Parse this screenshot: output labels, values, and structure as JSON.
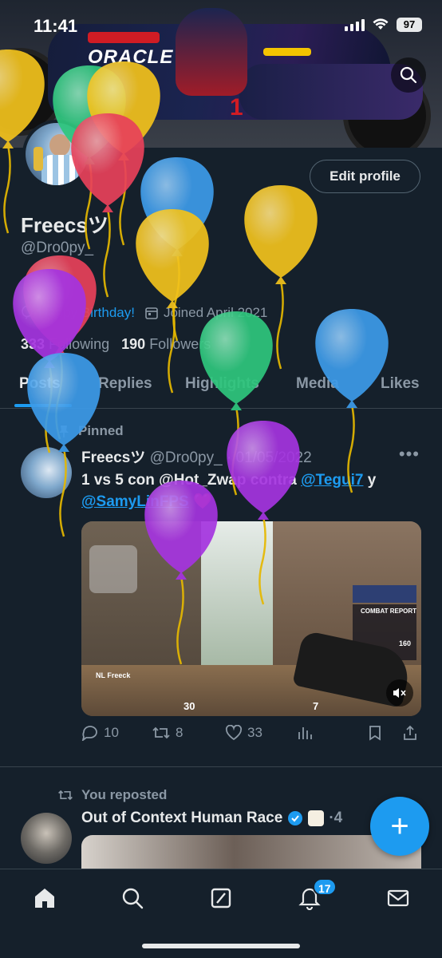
{
  "status_bar": {
    "time": "11:41",
    "battery": "97"
  },
  "profile": {
    "name": "Freecsツ",
    "handle": "@Dro0py_",
    "edit_label": "Edit profile",
    "birthday": "Happy Birthday!",
    "joined": "Joined April 2021",
    "following_count": "333",
    "following_label": "Following",
    "followers_count": "190",
    "followers_label": "Followers"
  },
  "banner": {
    "sponsor_text": "ORACLE",
    "driver_number": "1"
  },
  "tabs": [
    {
      "label": "Posts",
      "active": true
    },
    {
      "label": "Replies",
      "active": false
    },
    {
      "label": "Highlights",
      "active": false
    },
    {
      "label": "Media",
      "active": false
    },
    {
      "label": "Likes",
      "active": false
    }
  ],
  "pinned_post": {
    "pinned_label": "Pinned",
    "author": "Freecsツ",
    "handle": "@Dro0py_",
    "date": "· 01/05/2022",
    "text_part1": "1 vs 5 con @Hot_Zwap contra ",
    "mention1": "@Tegui7",
    "text_part2": " y ",
    "mention2": "@SamyLinFPS",
    "emoji": "❤️",
    "media_hud": {
      "health": "30",
      "ammo": "7",
      "panel_title": "COMBAT REPORT",
      "player_tag": "NL Freeck",
      "score": "160"
    },
    "stats": {
      "replies": "10",
      "reposts": "8",
      "likes": "33"
    }
  },
  "repost": {
    "label": "You reposted",
    "author": "Out of Context Human Race",
    "extra": "·4"
  },
  "nav": {
    "notifications_badge": "17"
  },
  "colors": {
    "background": "#15202b",
    "accent": "#1d9bf0",
    "muted": "#8b98a5",
    "text": "#e7e9ea"
  },
  "overlay": {
    "type": "birthday-balloons",
    "colors": [
      "#f2c21c",
      "#2ec77d",
      "#e8415a",
      "#3d9be9",
      "#a534e0"
    ]
  }
}
